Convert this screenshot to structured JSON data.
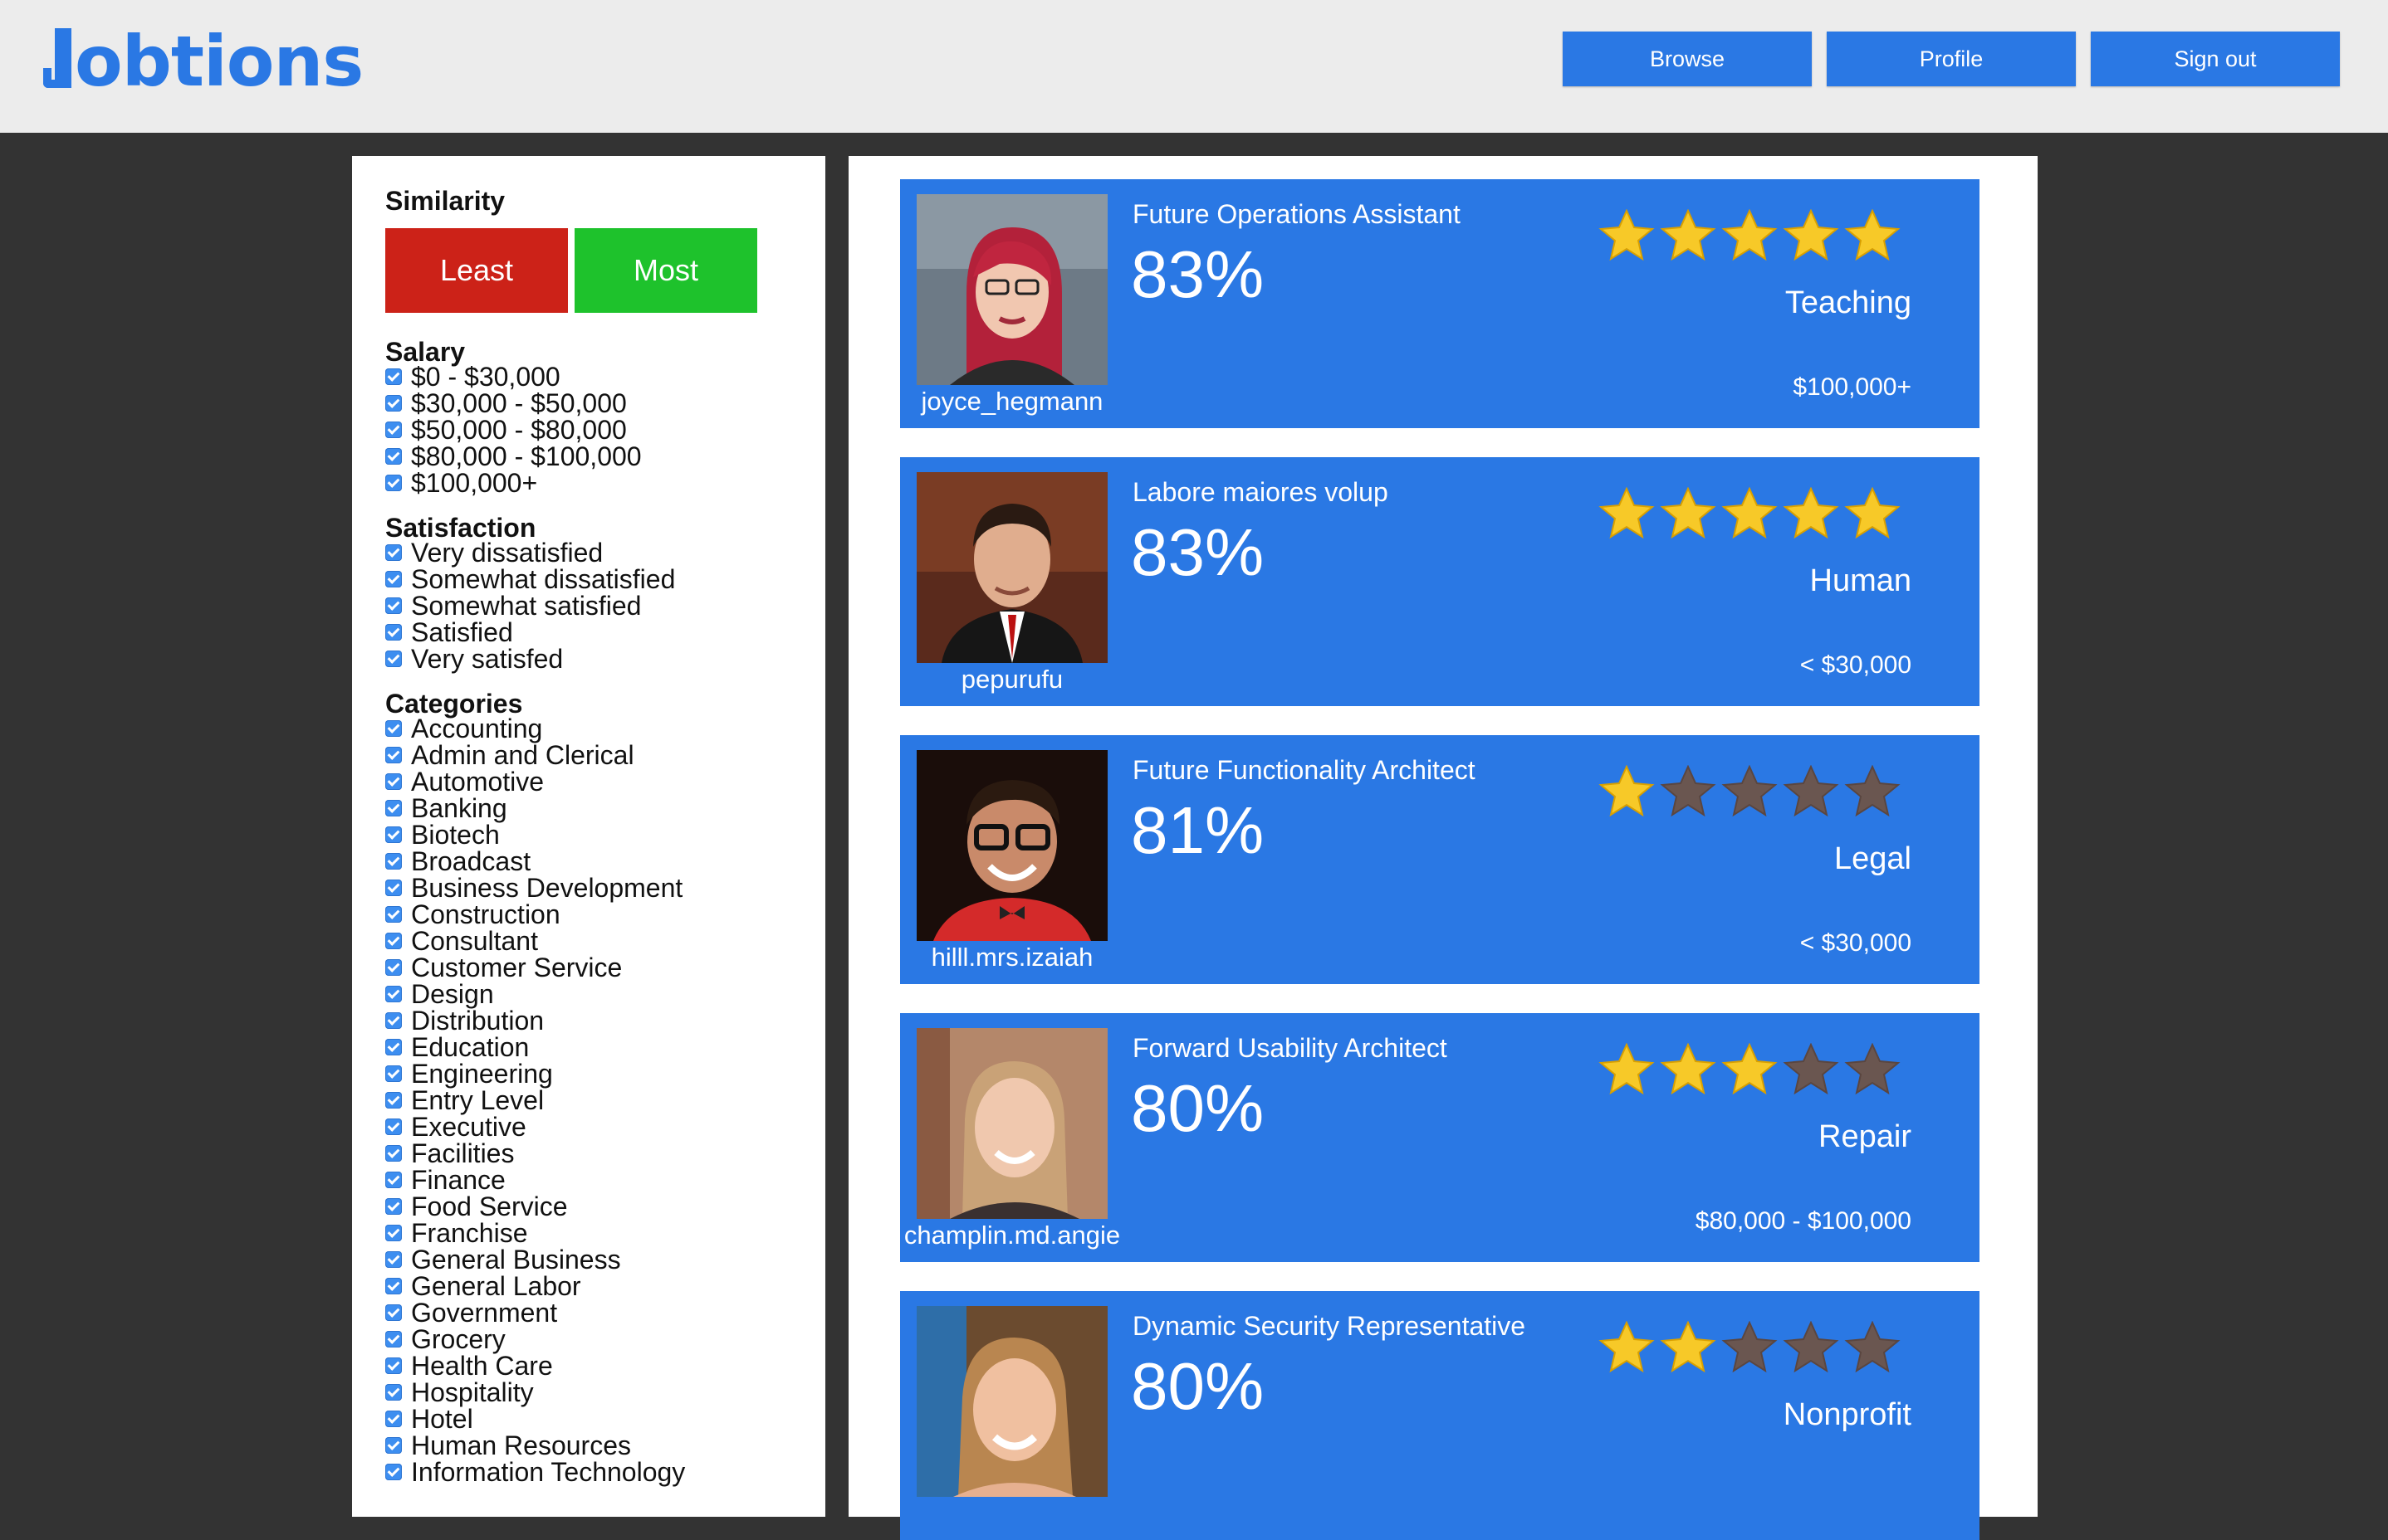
{
  "header": {
    "logo_text": "obtions",
    "nav": {
      "browse": "Browse",
      "profile": "Profile",
      "sign_out": "Sign out"
    }
  },
  "colors": {
    "accent": "#2a78e4",
    "least": "#cc2218",
    "most": "#1ec22c",
    "background": "#333333"
  },
  "filters": {
    "similarity": {
      "title": "Similarity",
      "least": "Least",
      "most": "Most"
    },
    "salary": {
      "title": "Salary",
      "options": [
        "$0 - $30,000",
        "$30,000 - $50,000",
        "$50,000 - $80,000",
        "$80,000 - $100,000",
        "$100,000+"
      ]
    },
    "satisfaction": {
      "title": "Satisfaction",
      "options": [
        "Very dissatisfied",
        "Somewhat dissatisfied",
        "Somewhat satisfied",
        "Satisfied",
        "Very satisfed"
      ]
    },
    "categories": {
      "title": "Categories",
      "options": [
        "Accounting",
        "Admin and Clerical",
        "Automotive",
        "Banking",
        "Biotech",
        "Broadcast",
        "Business Development",
        "Construction",
        "Consultant",
        "Customer Service",
        "Design",
        "Distribution",
        "Education",
        "Engineering",
        "Entry Level",
        "Executive",
        "Facilities",
        "Finance",
        "Food Service",
        "Franchise",
        "General Business",
        "General Labor",
        "Government",
        "Grocery",
        "Health Care",
        "Hospitality",
        "Hotel",
        "Human Resources",
        "Information Technology"
      ]
    }
  },
  "results": [
    {
      "username": "joyce_hegmann",
      "title": "Future Operations Assistant",
      "match": "83%",
      "rating": 5,
      "category": "Teaching",
      "salary": "$100,000+"
    },
    {
      "username": "pepurufu",
      "title": "Labore maiores volup",
      "match": "83%",
      "rating": 5,
      "category": "Human",
      "salary": "< $30,000"
    },
    {
      "username": "hilll.mrs.izaiah",
      "title": "Future Functionality Architect",
      "match": "81%",
      "rating": 1,
      "category": "Legal",
      "salary": "< $30,000"
    },
    {
      "username": "champlin.md.angie",
      "title": "Forward Usability Architect",
      "match": "80%",
      "rating": 3,
      "category": "Repair",
      "salary": "$80,000 - $100,000"
    },
    {
      "username": "",
      "title": "Dynamic Security Representative",
      "match": "80%",
      "rating": 2,
      "category": "Nonprofit",
      "salary": ""
    }
  ]
}
